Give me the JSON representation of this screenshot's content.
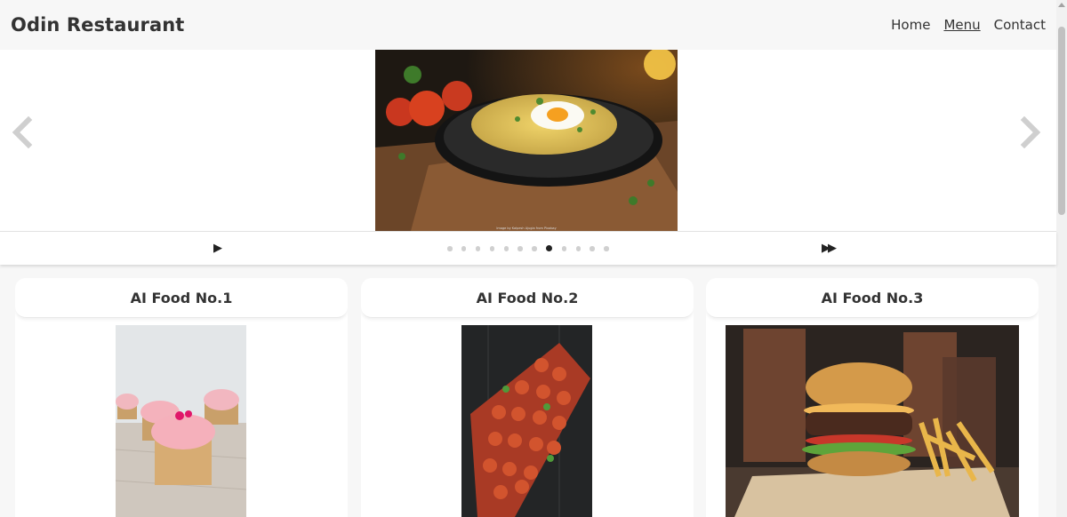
{
  "header": {
    "title": "Odin Restaurant",
    "nav": [
      {
        "label": "Home",
        "active": false
      },
      {
        "label": "Menu",
        "active": true
      },
      {
        "label": "Contact",
        "active": false
      }
    ]
  },
  "carousel": {
    "image_alt": "Omelette with fried egg on a dark plate",
    "credit": "Image by Kalpesh Ajugia from Pixabay",
    "prev_icon": "chevron-left-icon",
    "next_icon": "chevron-right-icon",
    "play_label": "▶",
    "fast_forward_label": "▶▶",
    "slide_count": 12,
    "active_slide": 8
  },
  "cards": [
    {
      "title": "AI Food No.1",
      "image_alt": "Pink frosted cupcakes"
    },
    {
      "title": "AI Food No.2",
      "image_alt": "Meatballs on a red platter"
    },
    {
      "title": "AI Food No.3",
      "image_alt": "Cheeseburger with fries"
    }
  ],
  "colors": {
    "background": "#f7f7f7",
    "surface": "#ffffff",
    "text": "#333333",
    "dot_inactive": "#d0d0d0",
    "dot_active": "#222222"
  }
}
